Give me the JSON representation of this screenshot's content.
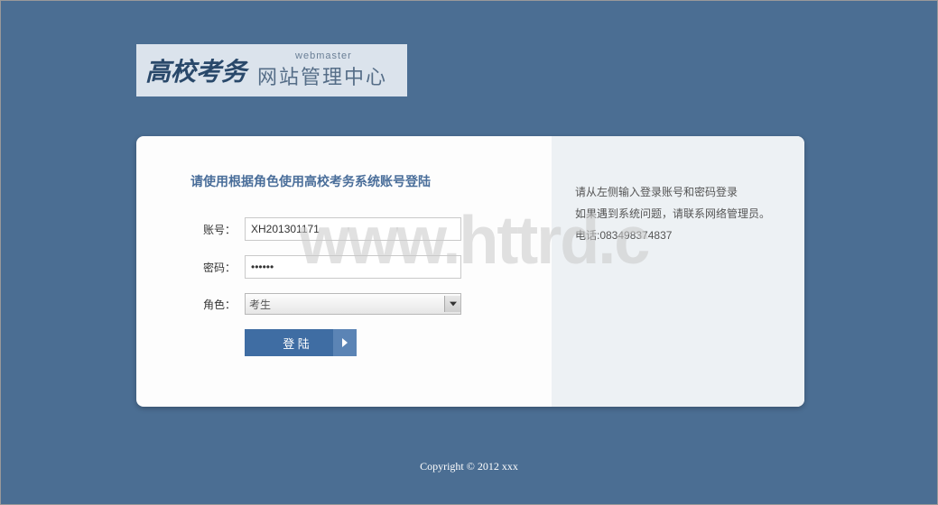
{
  "logo": {
    "script": "高校考务",
    "webmaster": "webmaster",
    "subtitle": "网站管理中心"
  },
  "form": {
    "title": "请使用根据角色使用高校考务系统账号登陆",
    "account_label": "账号：",
    "account_value": "XH201301171",
    "password_label": "密码：",
    "password_value": "••••••",
    "role_label": "角色：",
    "role_value": "考生",
    "login_label": "登 陆"
  },
  "info": {
    "line1": "请从左侧输入登录账号和密码登录",
    "line2": "如果遇到系统问题，请联系网络管理员。",
    "line3": "电话:083498374837"
  },
  "watermark": "www.httrd.c",
  "footer": "Copyright © 2012 xxx"
}
